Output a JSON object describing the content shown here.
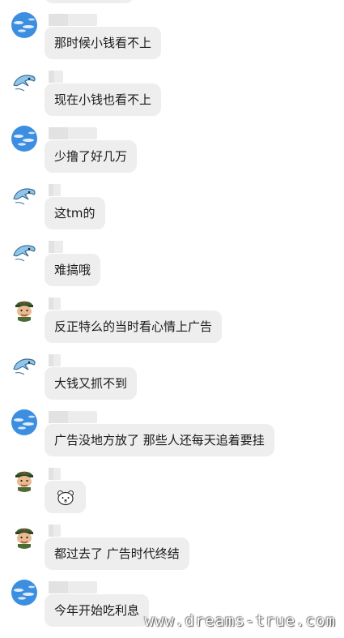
{
  "messages": [
    {
      "avatar": "blue-sky-avatar",
      "text": "那时候小钱看不上"
    },
    {
      "avatar": "dolphin-avatar",
      "text": "现在小钱也看不上"
    },
    {
      "avatar": "blue-sky-avatar",
      "text": "少撸了好几万"
    },
    {
      "avatar": "dolphin-avatar",
      "text": "这tm的"
    },
    {
      "avatar": "dolphin-avatar",
      "text": "难搞哦"
    },
    {
      "avatar": "soldier-avatar",
      "text": "反正特么的当时看心情上广告"
    },
    {
      "avatar": "dolphin-avatar",
      "text": "大钱又抓不到"
    },
    {
      "avatar": "blue-sky-avatar",
      "text": "广告没地方放了 那些人还每天追着要挂"
    },
    {
      "avatar": "soldier-avatar",
      "sticker": "bear-face-emoji",
      "text": ""
    },
    {
      "avatar": "soldier-avatar",
      "text": "都过去了 广告时代终结"
    },
    {
      "avatar": "blue-sky-avatar",
      "text": "今年开始吃利息"
    }
  ],
  "watermark": "www.dreams-true.com",
  "colors": {
    "bubble": "#eeeeee",
    "background": "#ffffff",
    "text": "#1a1a1a"
  }
}
